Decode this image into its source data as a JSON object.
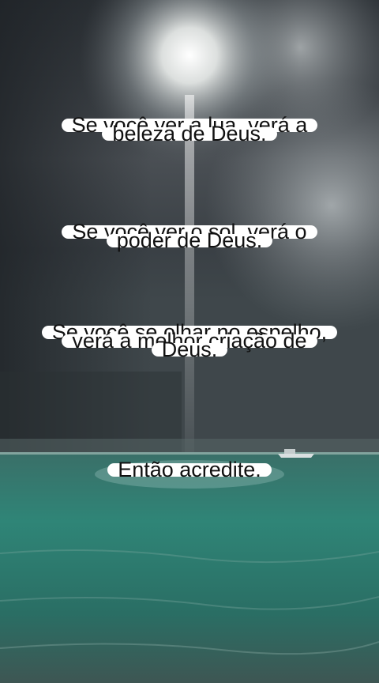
{
  "caption": {
    "stanza1": {
      "line1": "Se você ver a lua, verá a",
      "line2": "beleza de Deus."
    },
    "stanza2": {
      "line1": "Se você ver o sol, verá o",
      "line2": "poder de Deus."
    },
    "stanza3": {
      "line1": "Se você se olhar no espelho,",
      "line2": "verá a melhor criação de",
      "line3": "Deus."
    },
    "stanza4": {
      "line1": "Então acredite."
    }
  },
  "scene": {
    "sky_color": "#3a4046",
    "sea_color": "#2f7e72",
    "sun_color": "#f4f6f4",
    "text_box_color": "#ffffff",
    "text_color": "#111111"
  }
}
